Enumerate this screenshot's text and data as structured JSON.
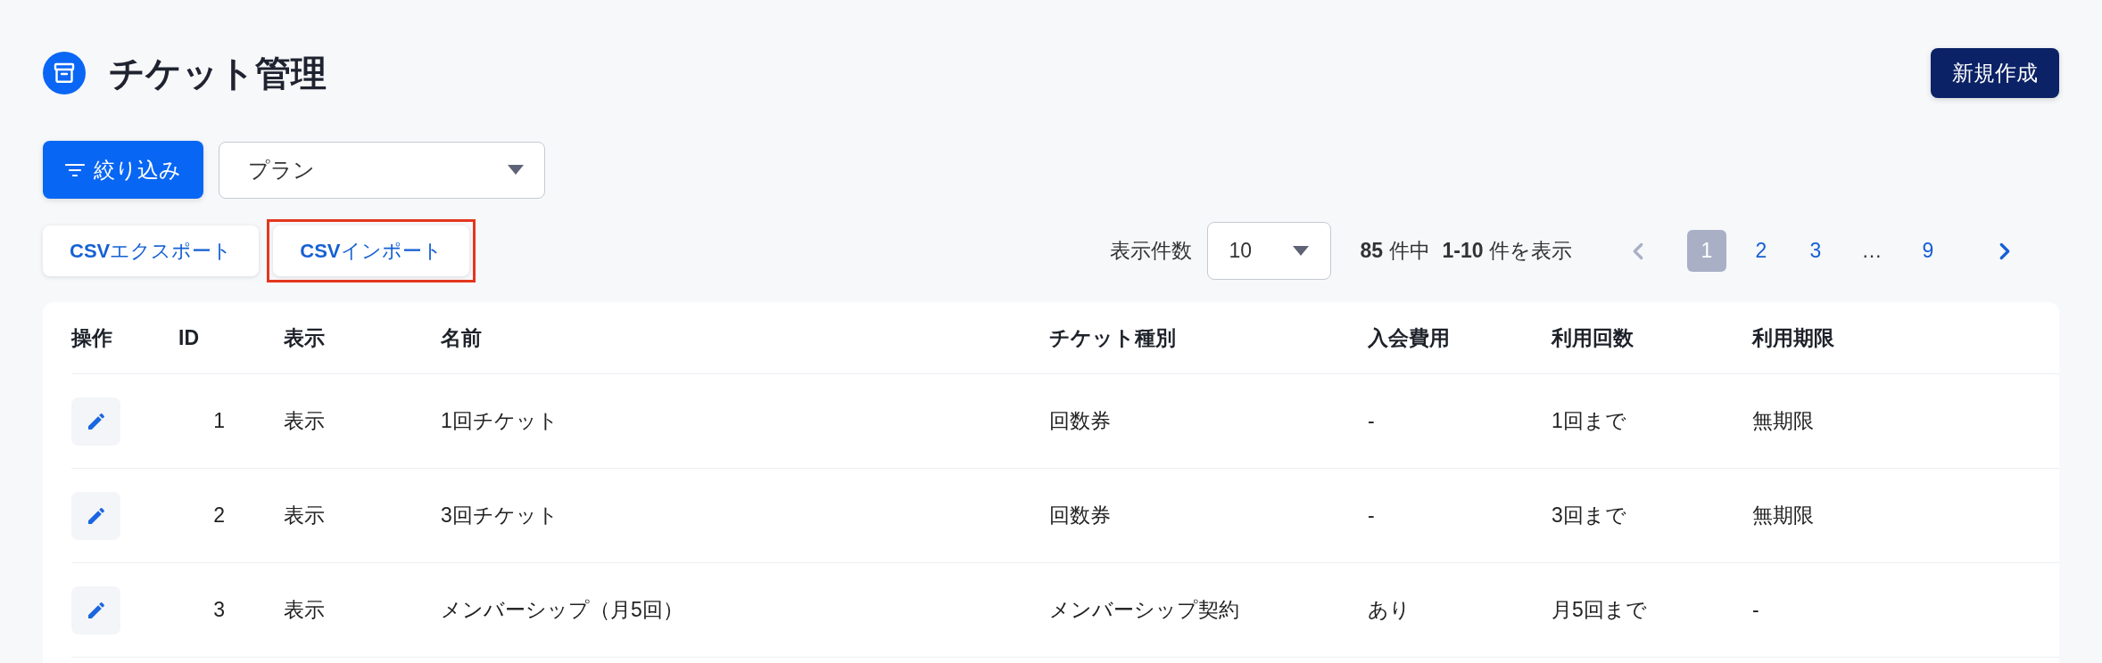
{
  "header": {
    "title": "チケット管理",
    "new_button": "新規作成"
  },
  "filter_bar": {
    "filter_button": "絞り込み",
    "plan_select": {
      "value": "プラン"
    }
  },
  "csv_buttons": [
    {
      "label": "**CSV**エクスポート",
      "highlighted": false
    },
    {
      "label": "**CSV**インポート",
      "highlighted": true
    }
  ],
  "pagination": {
    "per_page_label": "表示件数",
    "per_page_value": "10",
    "total": "**85** 件中",
    "range": "**1-10** 件を表示",
    "previous": {
      "disabled": true
    },
    "pages": [
      {
        "kind": "page",
        "label": "1",
        "selected": true
      },
      {
        "kind": "page",
        "label": "2",
        "selected": false
      },
      {
        "kind": "page",
        "label": "3",
        "selected": false
      },
      {
        "kind": "ellipsis",
        "label": "…"
      },
      {
        "kind": "page",
        "label": "9",
        "selected": false
      }
    ],
    "next": {
      "disabled": false
    }
  },
  "table": {
    "columns": [
      "操作",
      "ID",
      "表示",
      "名前",
      "チケット種別",
      "入会費用",
      "利用回数",
      "利用期限"
    ],
    "rows": [
      {
        "cells": [
          "",
          "1",
          "表示",
          "1回チケット",
          "回数券",
          "-",
          "1回まで",
          "無期限"
        ]
      },
      {
        "cells": [
          "",
          "2",
          "表示",
          "3回チケット",
          "回数券",
          "-",
          "3回まで",
          "無期限"
        ]
      },
      {
        "cells": [
          "",
          "3",
          "表示",
          "メンバーシップ（月5回）",
          "メンバーシップ契約",
          "あり",
          "月5回まで",
          "-"
        ]
      }
    ]
  }
}
